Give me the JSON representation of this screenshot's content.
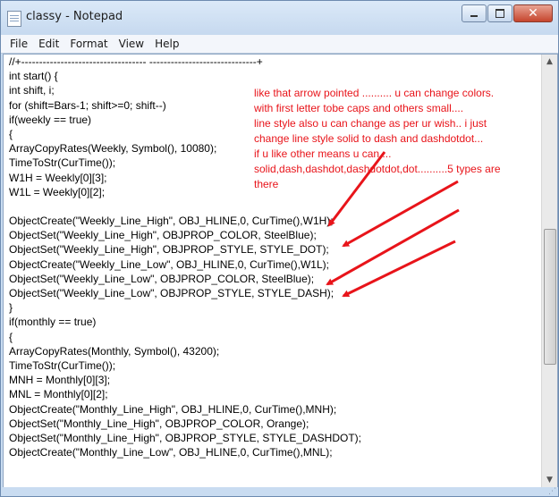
{
  "window": {
    "title": "classy - Notepad",
    "close_glyph": "✕"
  },
  "menu": [
    "File",
    "Edit",
    "Format",
    "View",
    "Help"
  ],
  "scrollbar": {
    "up": "▲",
    "down": "▼"
  },
  "status": {
    "grip": "⋰"
  },
  "code_lines": [
    "//+----------------------------------- ------------------------------+",
    "int start() {",
    "int shift, i;",
    "for (shift=Bars-1; shift>=0; shift--)",
    "if(weekly == true)",
    "{",
    "ArrayCopyRates(Weekly, Symbol(), 10080);",
    "TimeToStr(CurTime());",
    "W1H = Weekly[0][3];",
    "W1L = Weekly[0][2];",
    "",
    "ObjectCreate(\"Weekly_Line_High\", OBJ_HLINE,0, CurTime(),W1H);",
    "ObjectSet(\"Weekly_Line_High\", OBJPROP_COLOR, SteelBlue);",
    "ObjectSet(\"Weekly_Line_High\", OBJPROP_STYLE, STYLE_DOT);",
    "ObjectCreate(\"Weekly_Line_Low\", OBJ_HLINE,0, CurTime(),W1L);",
    "ObjectSet(\"Weekly_Line_Low\", OBJPROP_COLOR, SteelBlue);",
    "ObjectSet(\"Weekly_Line_Low\", OBJPROP_STYLE, STYLE_DASH);",
    "}",
    "if(monthly == true)",
    "{",
    "ArrayCopyRates(Monthly, Symbol(), 43200);",
    "TimeToStr(CurTime());",
    "MNH = Monthly[0][3];",
    "MNL = Monthly[0][2];",
    "ObjectCreate(\"Monthly_Line_High\", OBJ_HLINE,0, CurTime(),MNH);",
    "ObjectSet(\"Monthly_Line_High\", OBJPROP_COLOR, Orange);",
    "ObjectSet(\"Monthly_Line_High\", OBJPROP_STYLE, STYLE_DASHDOT);",
    "ObjectCreate(\"Monthly_Line_Low\", OBJ_HLINE,0, CurTime(),MNL);"
  ],
  "annotation_lines": [
    "like that arrow pointed .......... u can change colors.",
    "with first letter tobe caps and others small....",
    "line style also u can change as per ur wish.. i just",
    "change line style solid to dash and dashdotdot...",
    "if u like other means u can ...",
    "solid,dash,dashdot,dashdotdot,dot..........5 types are",
    "there"
  ],
  "colors": {
    "annotation": "#e8141a",
    "titlebar": "#c9dcf1"
  }
}
